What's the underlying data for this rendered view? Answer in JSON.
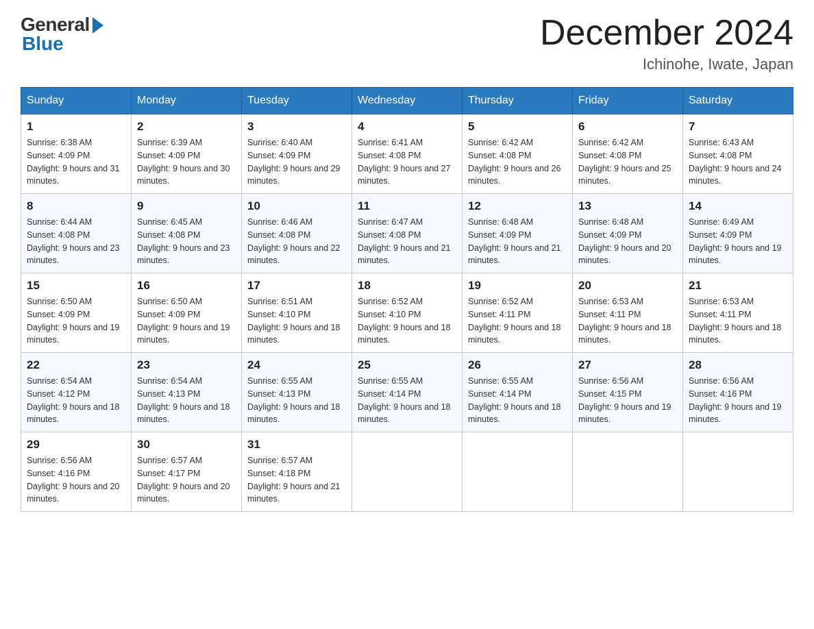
{
  "header": {
    "logo_general": "General",
    "logo_blue": "Blue",
    "month_title": "December 2024",
    "subtitle": "Ichinohe, Iwate, Japan"
  },
  "days_of_week": [
    "Sunday",
    "Monday",
    "Tuesday",
    "Wednesday",
    "Thursday",
    "Friday",
    "Saturday"
  ],
  "weeks": [
    [
      {
        "day": "1",
        "sunrise": "6:38 AM",
        "sunset": "4:09 PM",
        "daylight": "9 hours and 31 minutes."
      },
      {
        "day": "2",
        "sunrise": "6:39 AM",
        "sunset": "4:09 PM",
        "daylight": "9 hours and 30 minutes."
      },
      {
        "day": "3",
        "sunrise": "6:40 AM",
        "sunset": "4:09 PM",
        "daylight": "9 hours and 29 minutes."
      },
      {
        "day": "4",
        "sunrise": "6:41 AM",
        "sunset": "4:08 PM",
        "daylight": "9 hours and 27 minutes."
      },
      {
        "day": "5",
        "sunrise": "6:42 AM",
        "sunset": "4:08 PM",
        "daylight": "9 hours and 26 minutes."
      },
      {
        "day": "6",
        "sunrise": "6:42 AM",
        "sunset": "4:08 PM",
        "daylight": "9 hours and 25 minutes."
      },
      {
        "day": "7",
        "sunrise": "6:43 AM",
        "sunset": "4:08 PM",
        "daylight": "9 hours and 24 minutes."
      }
    ],
    [
      {
        "day": "8",
        "sunrise": "6:44 AM",
        "sunset": "4:08 PM",
        "daylight": "9 hours and 23 minutes."
      },
      {
        "day": "9",
        "sunrise": "6:45 AM",
        "sunset": "4:08 PM",
        "daylight": "9 hours and 23 minutes."
      },
      {
        "day": "10",
        "sunrise": "6:46 AM",
        "sunset": "4:08 PM",
        "daylight": "9 hours and 22 minutes."
      },
      {
        "day": "11",
        "sunrise": "6:47 AM",
        "sunset": "4:08 PM",
        "daylight": "9 hours and 21 minutes."
      },
      {
        "day": "12",
        "sunrise": "6:48 AM",
        "sunset": "4:09 PM",
        "daylight": "9 hours and 21 minutes."
      },
      {
        "day": "13",
        "sunrise": "6:48 AM",
        "sunset": "4:09 PM",
        "daylight": "9 hours and 20 minutes."
      },
      {
        "day": "14",
        "sunrise": "6:49 AM",
        "sunset": "4:09 PM",
        "daylight": "9 hours and 19 minutes."
      }
    ],
    [
      {
        "day": "15",
        "sunrise": "6:50 AM",
        "sunset": "4:09 PM",
        "daylight": "9 hours and 19 minutes."
      },
      {
        "day": "16",
        "sunrise": "6:50 AM",
        "sunset": "4:09 PM",
        "daylight": "9 hours and 19 minutes."
      },
      {
        "day": "17",
        "sunrise": "6:51 AM",
        "sunset": "4:10 PM",
        "daylight": "9 hours and 18 minutes."
      },
      {
        "day": "18",
        "sunrise": "6:52 AM",
        "sunset": "4:10 PM",
        "daylight": "9 hours and 18 minutes."
      },
      {
        "day": "19",
        "sunrise": "6:52 AM",
        "sunset": "4:11 PM",
        "daylight": "9 hours and 18 minutes."
      },
      {
        "day": "20",
        "sunrise": "6:53 AM",
        "sunset": "4:11 PM",
        "daylight": "9 hours and 18 minutes."
      },
      {
        "day": "21",
        "sunrise": "6:53 AM",
        "sunset": "4:11 PM",
        "daylight": "9 hours and 18 minutes."
      }
    ],
    [
      {
        "day": "22",
        "sunrise": "6:54 AM",
        "sunset": "4:12 PM",
        "daylight": "9 hours and 18 minutes."
      },
      {
        "day": "23",
        "sunrise": "6:54 AM",
        "sunset": "4:13 PM",
        "daylight": "9 hours and 18 minutes."
      },
      {
        "day": "24",
        "sunrise": "6:55 AM",
        "sunset": "4:13 PM",
        "daylight": "9 hours and 18 minutes."
      },
      {
        "day": "25",
        "sunrise": "6:55 AM",
        "sunset": "4:14 PM",
        "daylight": "9 hours and 18 minutes."
      },
      {
        "day": "26",
        "sunrise": "6:55 AM",
        "sunset": "4:14 PM",
        "daylight": "9 hours and 18 minutes."
      },
      {
        "day": "27",
        "sunrise": "6:56 AM",
        "sunset": "4:15 PM",
        "daylight": "9 hours and 19 minutes."
      },
      {
        "day": "28",
        "sunrise": "6:56 AM",
        "sunset": "4:16 PM",
        "daylight": "9 hours and 19 minutes."
      }
    ],
    [
      {
        "day": "29",
        "sunrise": "6:56 AM",
        "sunset": "4:16 PM",
        "daylight": "9 hours and 20 minutes."
      },
      {
        "day": "30",
        "sunrise": "6:57 AM",
        "sunset": "4:17 PM",
        "daylight": "9 hours and 20 minutes."
      },
      {
        "day": "31",
        "sunrise": "6:57 AM",
        "sunset": "4:18 PM",
        "daylight": "9 hours and 21 minutes."
      },
      null,
      null,
      null,
      null
    ]
  ]
}
